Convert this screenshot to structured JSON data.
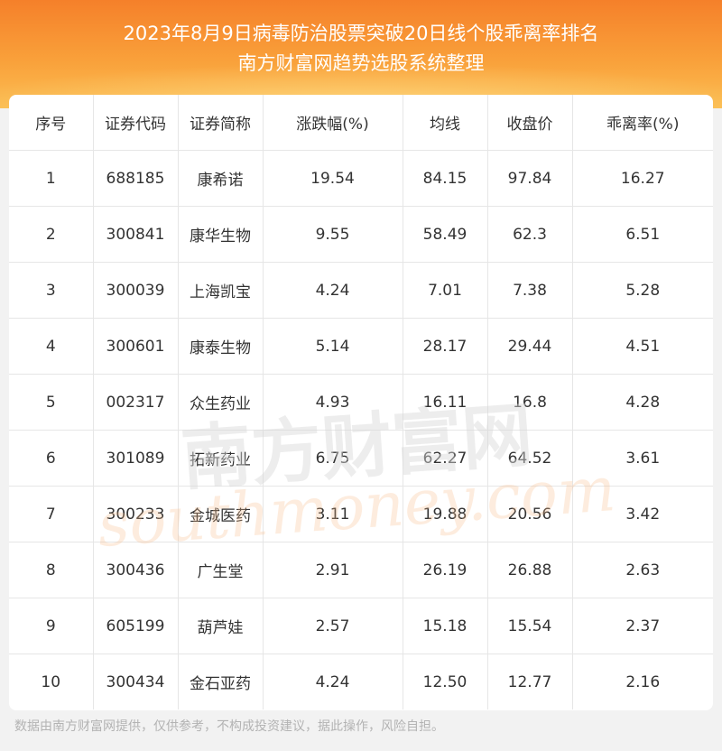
{
  "header": {
    "title_line1": "2023年8月9日病毒防治股票突破20日线个股乖离率排名",
    "title_line2": "南方财富网趋势选股系统整理"
  },
  "table": {
    "columns": [
      "序号",
      "证券代码",
      "证券简称",
      "涨跌幅(%)",
      "均线",
      "收盘价",
      "乖离率(%)"
    ],
    "rows": [
      [
        "1",
        "688185",
        "康希诺",
        "19.54",
        "84.15",
        "97.84",
        "16.27"
      ],
      [
        "2",
        "300841",
        "康华生物",
        "9.55",
        "58.49",
        "62.3",
        "6.51"
      ],
      [
        "3",
        "300039",
        "上海凯宝",
        "4.24",
        "7.01",
        "7.38",
        "5.28"
      ],
      [
        "4",
        "300601",
        "康泰生物",
        "5.14",
        "28.17",
        "29.44",
        "4.51"
      ],
      [
        "5",
        "002317",
        "众生药业",
        "4.93",
        "16.11",
        "16.8",
        "4.28"
      ],
      [
        "6",
        "301089",
        "拓新药业",
        "6.75",
        "62.27",
        "64.52",
        "3.61"
      ],
      [
        "7",
        "300233",
        "金城医药",
        "3.11",
        "19.88",
        "20.56",
        "3.42"
      ],
      [
        "8",
        "300436",
        "广生堂",
        "2.91",
        "26.19",
        "26.88",
        "2.63"
      ],
      [
        "9",
        "605199",
        "葫芦娃",
        "2.57",
        "15.18",
        "15.54",
        "2.37"
      ],
      [
        "10",
        "300434",
        "金石亚药",
        "4.24",
        "12.50",
        "12.77",
        "2.16"
      ]
    ]
  },
  "watermark": {
    "cn": "南方财富网",
    "en": "southmoney.com"
  },
  "footer": {
    "disclaimer": "数据由南方财富网提供，仅供参考，不构成投资建议，据此操作，风险自担。"
  },
  "colors": {
    "header_top": "#f5802a",
    "header_bottom": "#fbbd52",
    "text": "#333333",
    "grid": "#e6e6e6",
    "footer_text": "#b3b3b3"
  }
}
